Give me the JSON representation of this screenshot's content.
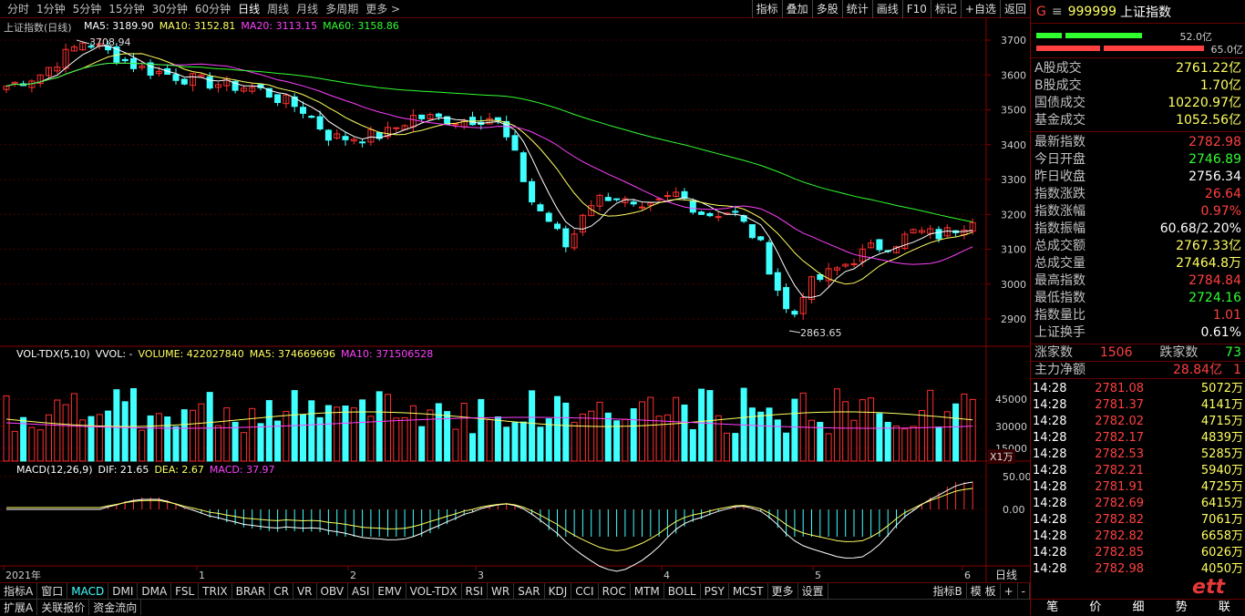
{
  "toolbar": {
    "periods": [
      "分时",
      "1分钟",
      "5分钟",
      "15分钟",
      "30分钟",
      "60分钟",
      "日线",
      "周线",
      "月线",
      "多周期",
      "更多 >"
    ],
    "active_period": "日线",
    "right_buttons": [
      "指标",
      "叠加",
      "多股",
      "统计",
      "画线",
      "F10",
      "标记",
      "+自选",
      "返回"
    ]
  },
  "chart": {
    "title": "上证指数(日线)",
    "ma_legend": [
      {
        "label": "MA5: 3189.90",
        "color": "#ffffff"
      },
      {
        "label": "MA10: 3152.81",
        "color": "#ffff60"
      },
      {
        "label": "MA20: 3113.15",
        "color": "#ff40ff"
      },
      {
        "label": "MA60: 3158.86",
        "color": "#30ff30"
      }
    ],
    "high_label": "3708.94",
    "low_label": "2863.65",
    "price_ticks": [
      "3700",
      "3600",
      "3500",
      "3400",
      "3300",
      "3200",
      "3100",
      "3000",
      "2900"
    ],
    "vol_legend": [
      {
        "label": "VOL-TDX(5,10)",
        "color": "#ffffff"
      },
      {
        "label": "VVOL: -",
        "color": "#ffffff"
      },
      {
        "label": "VOLUME: 422027840",
        "color": "#ffff60"
      },
      {
        "label": "MA5: 374669696",
        "color": "#ffff60"
      },
      {
        "label": "MA10: 371506528",
        "color": "#ff40ff"
      }
    ],
    "vol_ticks": [
      "45000",
      "30000",
      "15000"
    ],
    "vol_unit": "X1万",
    "macd_legend": [
      {
        "label": "MACD(12,26,9)",
        "color": "#ffffff"
      },
      {
        "label": "DIF: 21.65",
        "color": "#ffffff"
      },
      {
        "label": "DEA: 2.67",
        "color": "#ffff60"
      },
      {
        "label": "MACD: 37.97",
        "color": "#ff40ff"
      }
    ],
    "macd_ticks": [
      "50.00",
      "0.00"
    ],
    "x_labels": [
      "2021年",
      "1",
      "2",
      "3",
      "4",
      "5",
      "6"
    ],
    "x_period_label": "日线"
  },
  "bottom_tabs": {
    "row1": [
      "指标A",
      "窗口",
      "MACD",
      "DMI",
      "DMA",
      "FSL",
      "TRIX",
      "BRAR",
      "CR",
      "VR",
      "OBV",
      "ASI",
      "EMV",
      "VOL-TDX",
      "RSI",
      "WR",
      "SAR",
      "KDJ",
      "CCI",
      "ROC",
      "MTM",
      "BOLL",
      "PSY",
      "MCST",
      "更多",
      "设置"
    ],
    "row1_active": "MACD",
    "row1_right": [
      "指标B",
      "模 板",
      "+",
      "-"
    ],
    "row2": [
      "扩展A",
      "关联报价",
      "资金流向"
    ]
  },
  "side": {
    "prefix": "G",
    "menu_icon": "≡",
    "code": "999999",
    "name": "上证指数",
    "bar1_value": "52.0亿",
    "bar2_value": "65.0亿",
    "turnover": [
      {
        "k": "A股成交",
        "v": "2761.22亿"
      },
      {
        "k": "B股成交",
        "v": "1.70亿"
      },
      {
        "k": "国债成交",
        "v": "10220.97亿"
      },
      {
        "k": "基金成交",
        "v": "1052.56亿"
      }
    ],
    "quote": [
      {
        "k": "最新指数",
        "v": "2782.98",
        "c": "red"
      },
      {
        "k": "今日开盘",
        "v": "2746.89",
        "c": "grn"
      },
      {
        "k": "昨日收盘",
        "v": "2756.34",
        "c": "wht"
      },
      {
        "k": "指数涨跌",
        "v": "26.64",
        "c": "red"
      },
      {
        "k": "指数涨幅",
        "v": "0.97%",
        "c": "red"
      },
      {
        "k": "指数振幅",
        "v": "60.68/2.20%",
        "c": "wht"
      },
      {
        "k": "总成交额",
        "v": "2767.33亿",
        "c": "yel"
      },
      {
        "k": "总成交量",
        "v": "27464.8万",
        "c": "yel"
      },
      {
        "k": "最高指数",
        "v": "2784.84",
        "c": "red"
      },
      {
        "k": "最低指数",
        "v": "2724.16",
        "c": "grn"
      },
      {
        "k": "指数量比",
        "v": "1.01",
        "c": "red"
      },
      {
        "k": "上证换手",
        "v": "0.61%",
        "c": "wht"
      }
    ],
    "up_label": "涨家数",
    "up_count": "1506",
    "down_label": "跌家数",
    "down_count": "73",
    "net_label": "主力净额",
    "net_value": "28.84亿",
    "net_extra": "1",
    "trades": [
      {
        "t": "14:28",
        "p": "2781.08",
        "q": "5072万"
      },
      {
        "t": "14:28",
        "p": "2781.37",
        "q": "4141万"
      },
      {
        "t": "14:28",
        "p": "2782.02",
        "q": "4715万"
      },
      {
        "t": "14:28",
        "p": "2782.17",
        "q": "4839万"
      },
      {
        "t": "14:28",
        "p": "2782.53",
        "q": "5285万"
      },
      {
        "t": "14:28",
        "p": "2782.21",
        "q": "5940万"
      },
      {
        "t": "14:28",
        "p": "2781.91",
        "q": "4725万"
      },
      {
        "t": "14:28",
        "p": "2782.69",
        "q": "6415万"
      },
      {
        "t": "14:28",
        "p": "2782.82",
        "q": "7061万"
      },
      {
        "t": "14:28",
        "p": "2782.82",
        "q": "6658万"
      },
      {
        "t": "14:28",
        "p": "2782.85",
        "q": "6026万"
      },
      {
        "t": "14:28",
        "p": "2782.98",
        "q": "4050万"
      }
    ],
    "foot": [
      "笔",
      "价",
      "细",
      "势",
      "联"
    ],
    "watermark": "ett"
  },
  "colors": {
    "up": "#ff3030",
    "down": "#40ffff",
    "grid": "#600000",
    "ma5": "#ffffff",
    "ma10": "#ffff60",
    "ma20": "#ff40ff",
    "ma60": "#30ff30"
  }
}
